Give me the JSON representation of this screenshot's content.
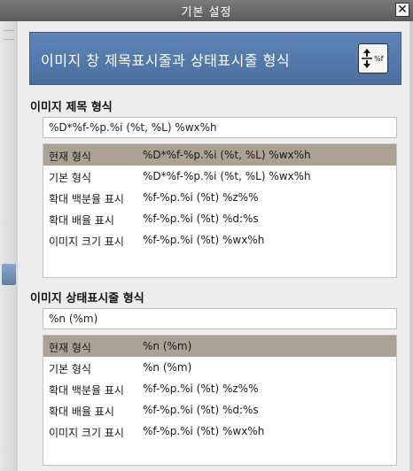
{
  "window": {
    "title": "기본 설정",
    "close_label": "✕"
  },
  "header": {
    "title": "이미지 창 제목표시줄과 상태표시줄 형식",
    "icon": "format-percent-icon"
  },
  "title_section": {
    "label": "이미지 제목 형식",
    "input_value": "%D*%f-%p.%i (%t, %L) %wx%h",
    "presets": [
      {
        "name": "현재 형식",
        "format": "%D*%f-%p.%i (%t, %L) %wx%h"
      },
      {
        "name": "기본 형식",
        "format": "%D*%f-%p.%i (%t, %L) %wx%h"
      },
      {
        "name": "확대 백분율 표시",
        "format": "%f-%p.%i (%t) %z%%"
      },
      {
        "name": "확대 배율 표시",
        "format": "%f-%p.%i (%t) %d:%s"
      },
      {
        "name": "이미지 크기 표시",
        "format": "%f-%p.%i (%t) %wx%h"
      }
    ],
    "selected_index": 0
  },
  "status_section": {
    "label": "이미지 상태표시줄 형식",
    "input_value": "%n (%m)",
    "presets": [
      {
        "name": "현재 형식",
        "format": "%n (%m)"
      },
      {
        "name": "기본 형식",
        "format": "%n (%m)"
      },
      {
        "name": "확대 백분율 표시",
        "format": "%f-%p.%i (%t) %z%%"
      },
      {
        "name": "확대 배율 표시",
        "format": "%f-%p.%i (%t) %d:%s"
      },
      {
        "name": "이미지 크기 표시",
        "format": "%f-%p.%i (%t) %wx%h"
      }
    ],
    "selected_index": 0
  },
  "colors": {
    "banner": "#5b81b3",
    "selected_row": "#a9a295",
    "titlebar": "#6b6b6b"
  }
}
